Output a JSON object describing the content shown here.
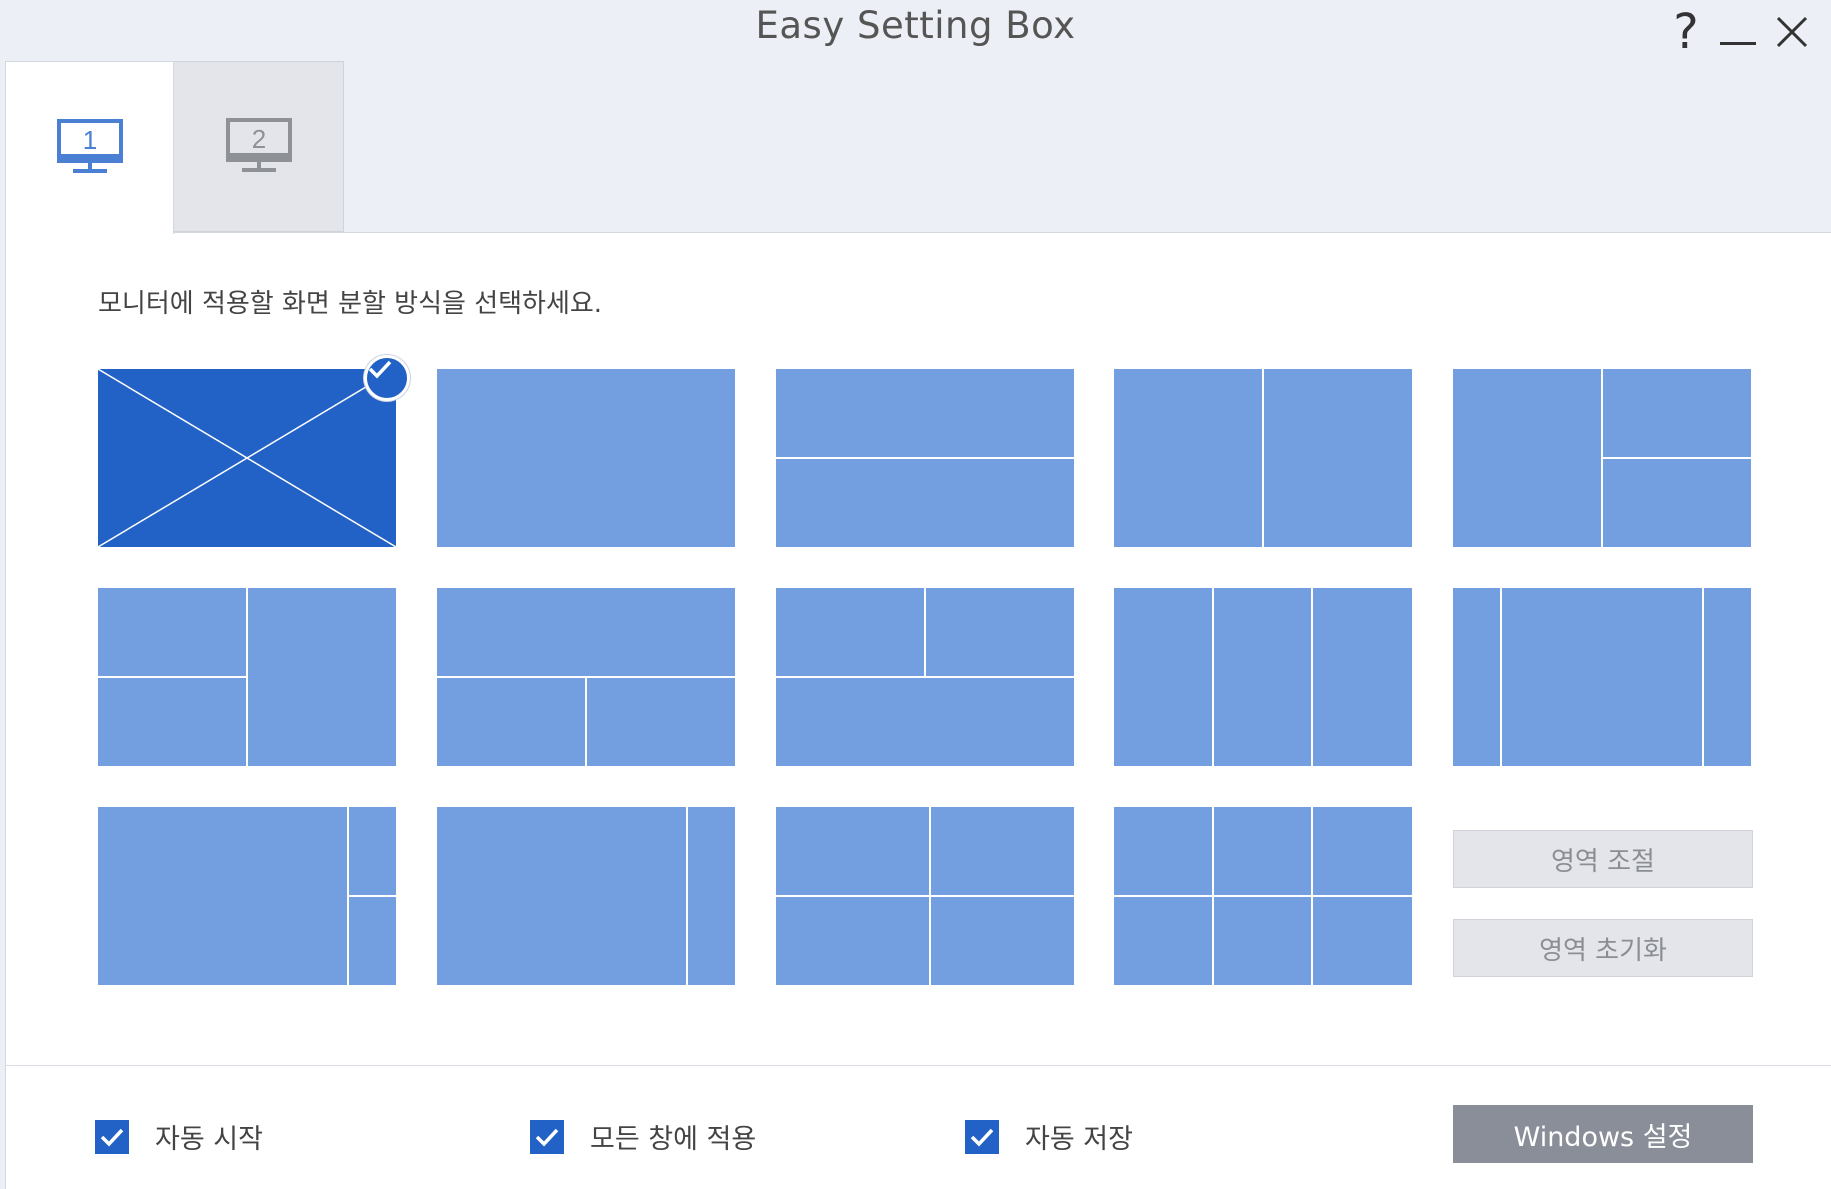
{
  "window": {
    "title": "Easy Setting Box"
  },
  "tabs": [
    {
      "label": "1",
      "active": true
    },
    {
      "label": "2",
      "active": false
    }
  ],
  "main": {
    "instruction": "모니터에 적용할 화면 분할 방식을 선택하세요.",
    "selected_layout": "layout-off",
    "region_adjust_label": "영역 조절",
    "region_reset_label": "영역 초기화"
  },
  "footer": {
    "auto_start_label": "자동 시작",
    "auto_start_checked": true,
    "apply_all_label": "모든 창에 적용",
    "apply_all_checked": true,
    "auto_save_label": "자동 저장",
    "auto_save_checked": true,
    "windows_settings_label": "Windows 설정"
  },
  "colors": {
    "accent": "#2261c6",
    "tile": "#739ee0",
    "disabled_button": "#e3e5ea",
    "windows_button": "#8a8e99"
  },
  "icons": {
    "help": "question-mark-icon",
    "minimize": "minimize-icon",
    "close": "close-icon",
    "monitor": "monitor-icon",
    "check": "checkmark-icon"
  }
}
